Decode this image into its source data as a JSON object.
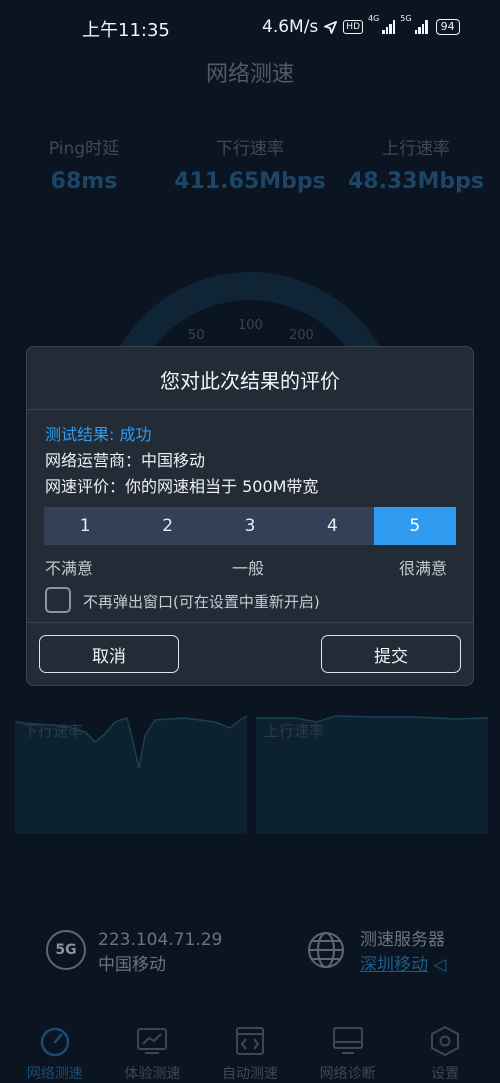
{
  "status_bar": {
    "time": "上午11:35",
    "net_speed": "4.6M/s",
    "hd_badge": "HD",
    "network_4g": "4G",
    "network_5g": "5G",
    "battery": "94"
  },
  "page": {
    "title": "网络测速"
  },
  "metrics": [
    {
      "label": "Ping时延",
      "value": "68ms"
    },
    {
      "label": "下行速率",
      "value": "411.65Mbps"
    },
    {
      "label": "上行速率",
      "value": "48.33Mbps"
    }
  ],
  "gauge": {
    "ticks": [
      "50",
      "100",
      "200"
    ]
  },
  "charts": {
    "download_label": "下行速率",
    "upload_label": "上行速率"
  },
  "info": {
    "ip_icon_text": "5G",
    "ip": "223.104.71.29",
    "carrier": "中国移动",
    "server_label": "测速服务器",
    "server_name": "深圳移动"
  },
  "nav": [
    {
      "label": "网络测速",
      "icon": "speedometer-icon",
      "active": true
    },
    {
      "label": "体验测速",
      "icon": "experience-chart-icon",
      "active": false
    },
    {
      "label": "自动测速",
      "icon": "auto-code-icon",
      "active": false
    },
    {
      "label": "网络诊断",
      "icon": "monitor-icon",
      "active": false
    },
    {
      "label": "设置",
      "icon": "settings-hexagon-icon",
      "active": false
    }
  ],
  "dialog": {
    "title": "您对此次结果的评价",
    "result_line": "测试结果: 成功",
    "carrier_line": "网络运营商：中国移动",
    "rating_line": "网速评价：你的网速相当于 500M带宽",
    "rating_options": [
      "1",
      "2",
      "3",
      "4",
      "5"
    ],
    "selected_rating": "5",
    "scale_low": "不满意",
    "scale_mid": "一般",
    "scale_high": "很满意",
    "checkbox_label": "不再弹出窗口(可在设置中重新开启)",
    "checkbox_checked": false,
    "cancel_label": "取消",
    "submit_label": "提交"
  },
  "colors": {
    "accent": "#2f9cf2",
    "dialog_bg": "#232b36",
    "screen_bg": "#0b1522"
  }
}
